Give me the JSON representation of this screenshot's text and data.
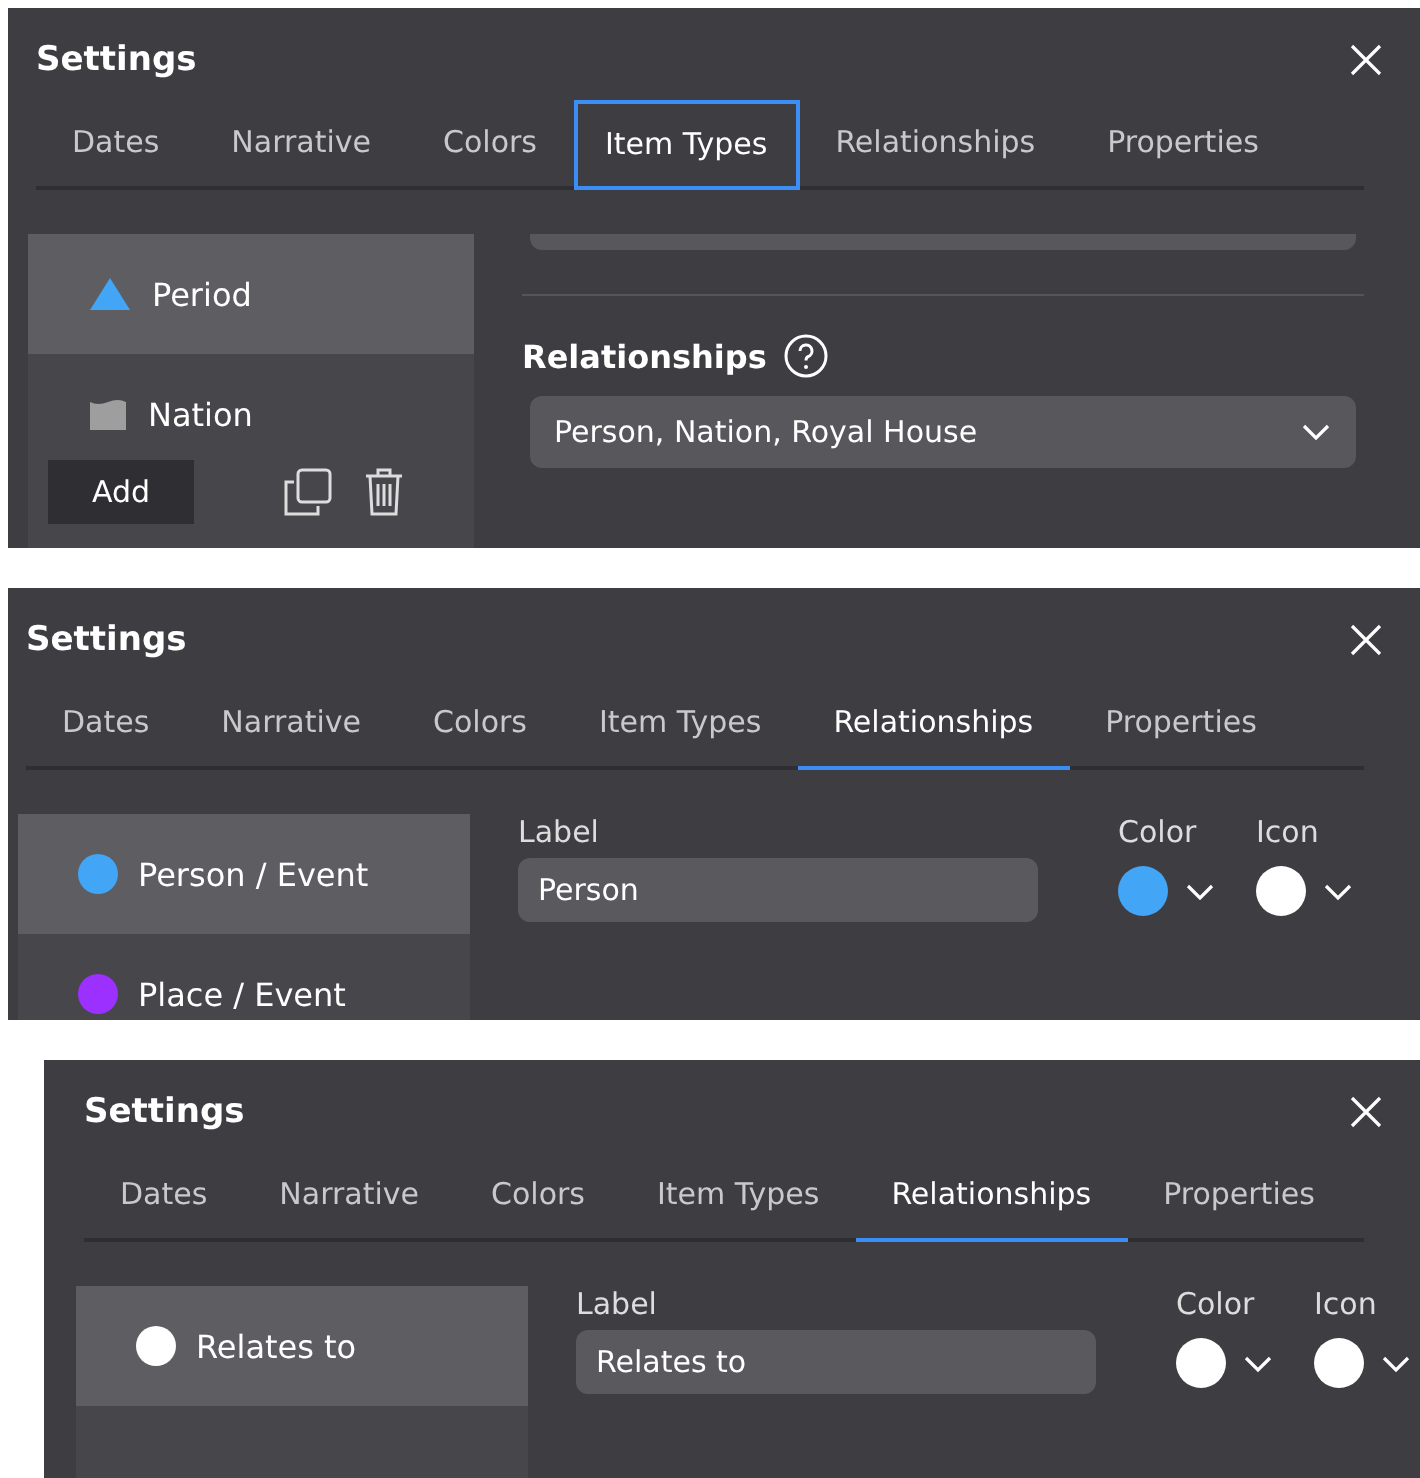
{
  "panels": [
    {
      "kind": "item_types",
      "title": "Settings",
      "tabs": [
        {
          "label": "Dates",
          "selected": false,
          "focused": false
        },
        {
          "label": "Narrative",
          "selected": false,
          "focused": false
        },
        {
          "label": "Colors",
          "selected": false,
          "focused": false
        },
        {
          "label": "Item Types",
          "selected": true,
          "focused": true
        },
        {
          "label": "Relationships",
          "selected": false,
          "focused": false
        },
        {
          "label": "Properties",
          "selected": false,
          "focused": false
        }
      ],
      "items": [
        {
          "label": "Period",
          "kind": "triangle",
          "color": "#42a5f5",
          "selected": true
        },
        {
          "label": "Nation",
          "kind": "flag",
          "color": "#9e9e9e",
          "selected": false
        }
      ],
      "add_button": "Add",
      "section_title": "Relationships",
      "dropdown_value": "Person, Nation, Royal House"
    },
    {
      "kind": "relationships",
      "title": "Settings",
      "tabs": [
        {
          "label": "Dates",
          "selected": false,
          "focused": false
        },
        {
          "label": "Narrative",
          "selected": false,
          "focused": false
        },
        {
          "label": "Colors",
          "selected": false,
          "focused": false
        },
        {
          "label": "Item Types",
          "selected": false,
          "focused": false
        },
        {
          "label": "Relationships",
          "selected": true,
          "focused": false
        },
        {
          "label": "Properties",
          "selected": false,
          "focused": false
        }
      ],
      "items": [
        {
          "label": "Person / Event",
          "kind": "dot",
          "color": "#42a5f5",
          "selected": true
        },
        {
          "label": "Place / Event",
          "kind": "dot",
          "color": "#9b30ff",
          "selected": false
        }
      ],
      "label_field": {
        "label": "Label",
        "value": "Person"
      },
      "color_picker": {
        "label": "Color",
        "color": "#42a5f5"
      },
      "icon_picker": {
        "label": "Icon",
        "color": "#ffffff"
      }
    },
    {
      "kind": "relationships",
      "title": "Settings",
      "tabs": [
        {
          "label": "Dates",
          "selected": false,
          "focused": false
        },
        {
          "label": "Narrative",
          "selected": false,
          "focused": false
        },
        {
          "label": "Colors",
          "selected": false,
          "focused": false
        },
        {
          "label": "Item Types",
          "selected": false,
          "focused": false
        },
        {
          "label": "Relationships",
          "selected": true,
          "focused": false
        },
        {
          "label": "Properties",
          "selected": false,
          "focused": false
        }
      ],
      "items": [
        {
          "label": "Relates to",
          "kind": "dot",
          "color": "#ffffff",
          "selected": true
        }
      ],
      "label_field": {
        "label": "Label",
        "value": "Relates to"
      },
      "color_picker": {
        "label": "Color",
        "color": "#ffffff"
      },
      "icon_picker": {
        "label": "Icon",
        "color": "#ffffff"
      }
    }
  ]
}
